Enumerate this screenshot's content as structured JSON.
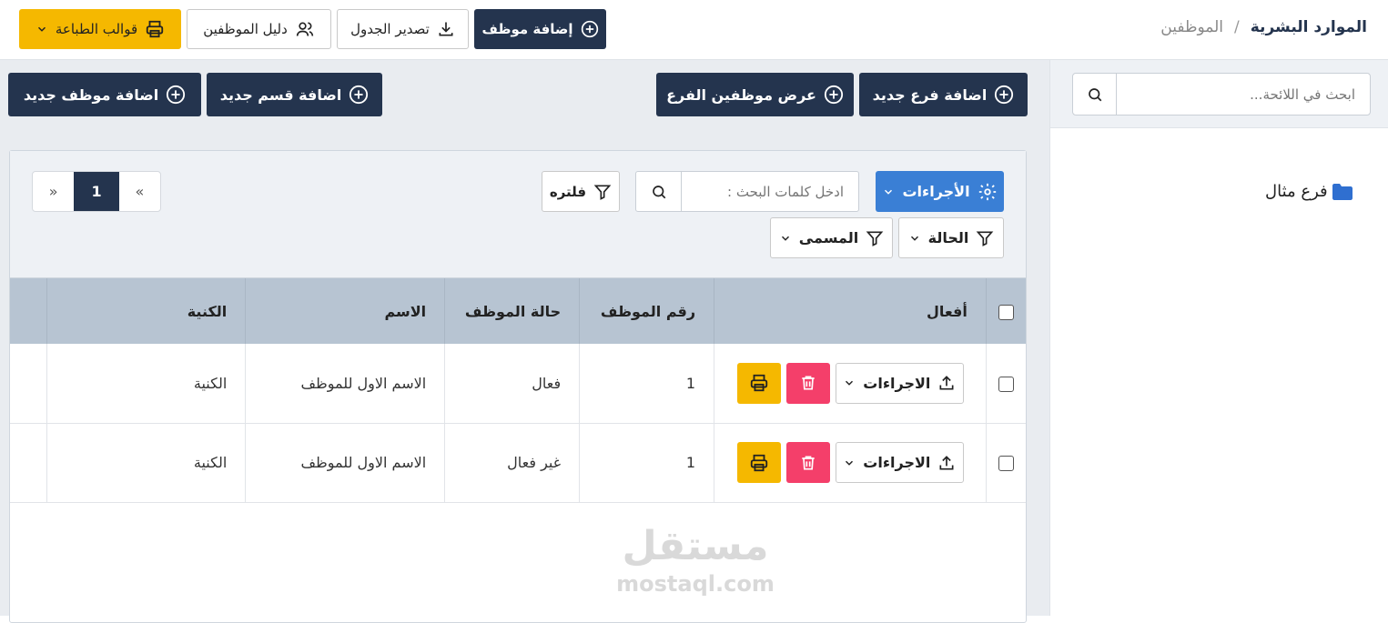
{
  "breadcrumb": {
    "root": "الموارد البشرية",
    "separator": "/",
    "current": "الموظفين"
  },
  "toolbar": {
    "add_employee": "إضافة موظف",
    "export_table": "تصدير الجدول",
    "employee_guide": "دليل الموظفين",
    "print_templates": "قوالب الطباعة"
  },
  "sidebar": {
    "search_placeholder": "ابحث في اللائحة...",
    "tree": [
      {
        "label": "فرع مثال",
        "icon": "folder-icon"
      }
    ]
  },
  "actions": {
    "add_branch": "اضافة فرع جديد",
    "view_branch_employees": "عرض موظفين الفرع",
    "add_department": "اضافة قسم جديد",
    "add_new_employee": "اضافة موظف جديد"
  },
  "table_controls": {
    "procedures": "الأجراءات",
    "search_placeholder": "ادخل كلمات البحث :",
    "filter": "فلتره",
    "status_filter": "الحالة",
    "title_filter": "المسمى"
  },
  "pagination": {
    "prev": "«",
    "current": "1",
    "next": "»"
  },
  "table": {
    "headers": [
      "أفعال",
      "رقم الموظف",
      "حالة الموظف",
      "الاسم",
      "الكنية"
    ],
    "row_action_label": "الاجراءات",
    "rows": [
      {
        "number": "1",
        "status": "فعال",
        "name": "الاسم الاول للموظف",
        "nickname": "الكنية"
      },
      {
        "number": "1",
        "status": "غير فعال",
        "name": "الاسم الاول للموظف",
        "nickname": "الكنية"
      }
    ]
  },
  "watermark": {
    "arabic": "مستقل",
    "latin": "mostaql.com"
  },
  "colors": {
    "dark": "#24344e",
    "yellow": "#f5b800",
    "blue": "#3a7fd5",
    "red": "#f43f6a",
    "header": "#b7c4d2"
  }
}
